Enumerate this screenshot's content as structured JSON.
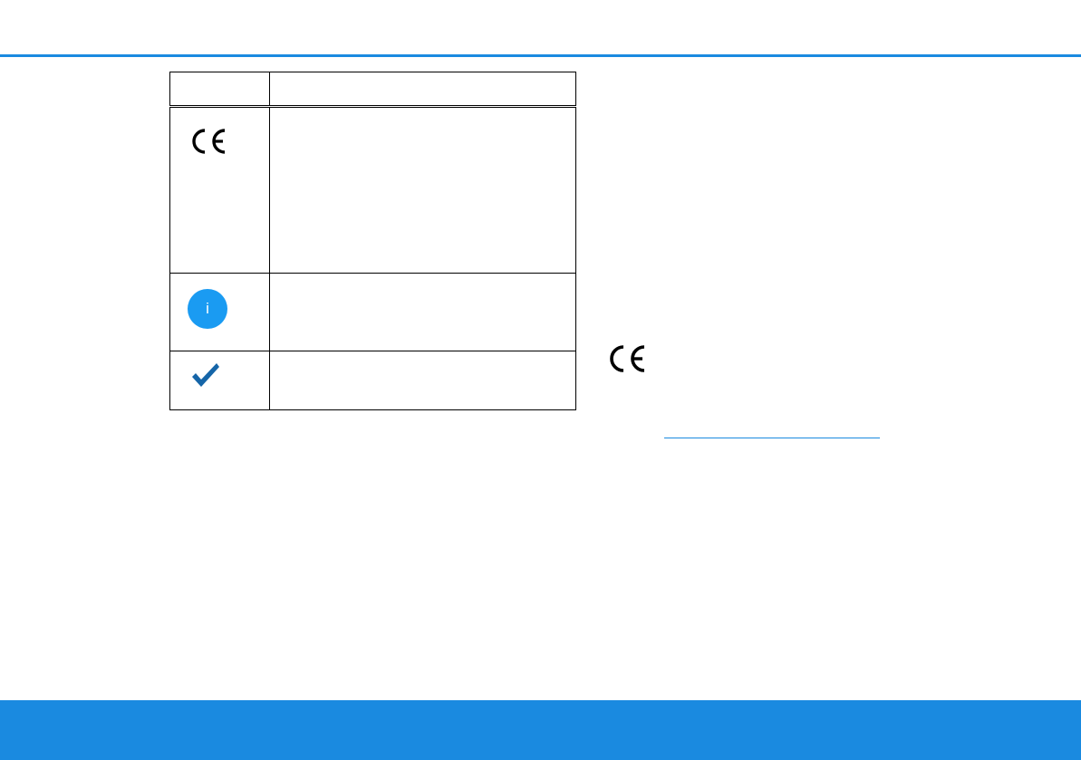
{
  "table": {
    "header": {
      "symbol": "",
      "description": ""
    },
    "rows": [
      {
        "icon": "ce-mark-icon",
        "description": ""
      },
      {
        "icon": "info-icon",
        "icon_text": "i",
        "description": ""
      },
      {
        "icon": "check-icon",
        "description": ""
      }
    ]
  },
  "conformity": {
    "icon": "ce-mark-icon",
    "link_text": ""
  },
  "colors": {
    "accent": "#1a8ae0",
    "info_icon": "#1a9bf2",
    "check_icon": "#1565a8"
  }
}
